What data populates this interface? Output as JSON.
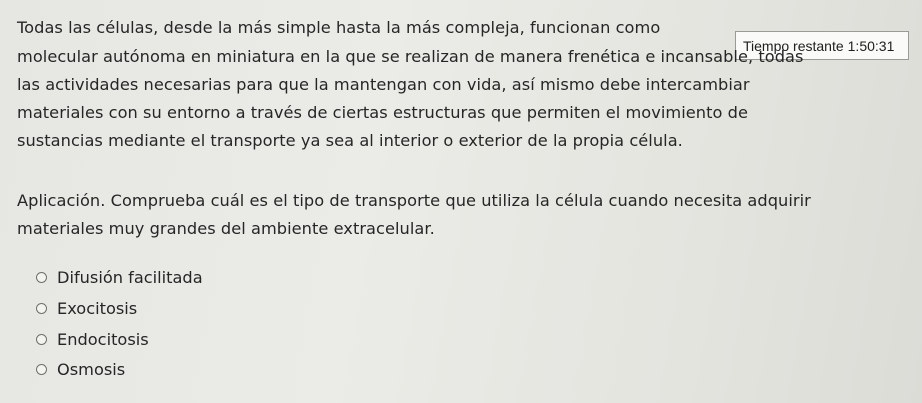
{
  "timer": {
    "label": "Tiempo restante",
    "value": "1:50:31"
  },
  "question": {
    "paragraph_lines": [
      "Todas las células, desde la más simple hasta la más compleja, funcionan como",
      "molecular autónoma en miniatura en la que se realizan de manera frenética e incansable, todas",
      "las actividades necesarias para que la mantengan con vida, así mismo debe intercambiar",
      "materiales con su entorno a través de ciertas estructuras que permiten el movimiento de",
      "sustancias mediante el transporte ya sea al interior o exterior de la propia célula."
    ],
    "prompt_lines": [
      "Aplicación. Comprueba cuál es el tipo de transporte que utiliza la célula cuando necesita adquirir",
      "materiales muy grandes del ambiente extracelular."
    ]
  },
  "options": [
    {
      "label": "Difusión facilitada"
    },
    {
      "label": "Exocitosis"
    },
    {
      "label": "Endocitosis"
    },
    {
      "label": "Osmosis"
    }
  ]
}
